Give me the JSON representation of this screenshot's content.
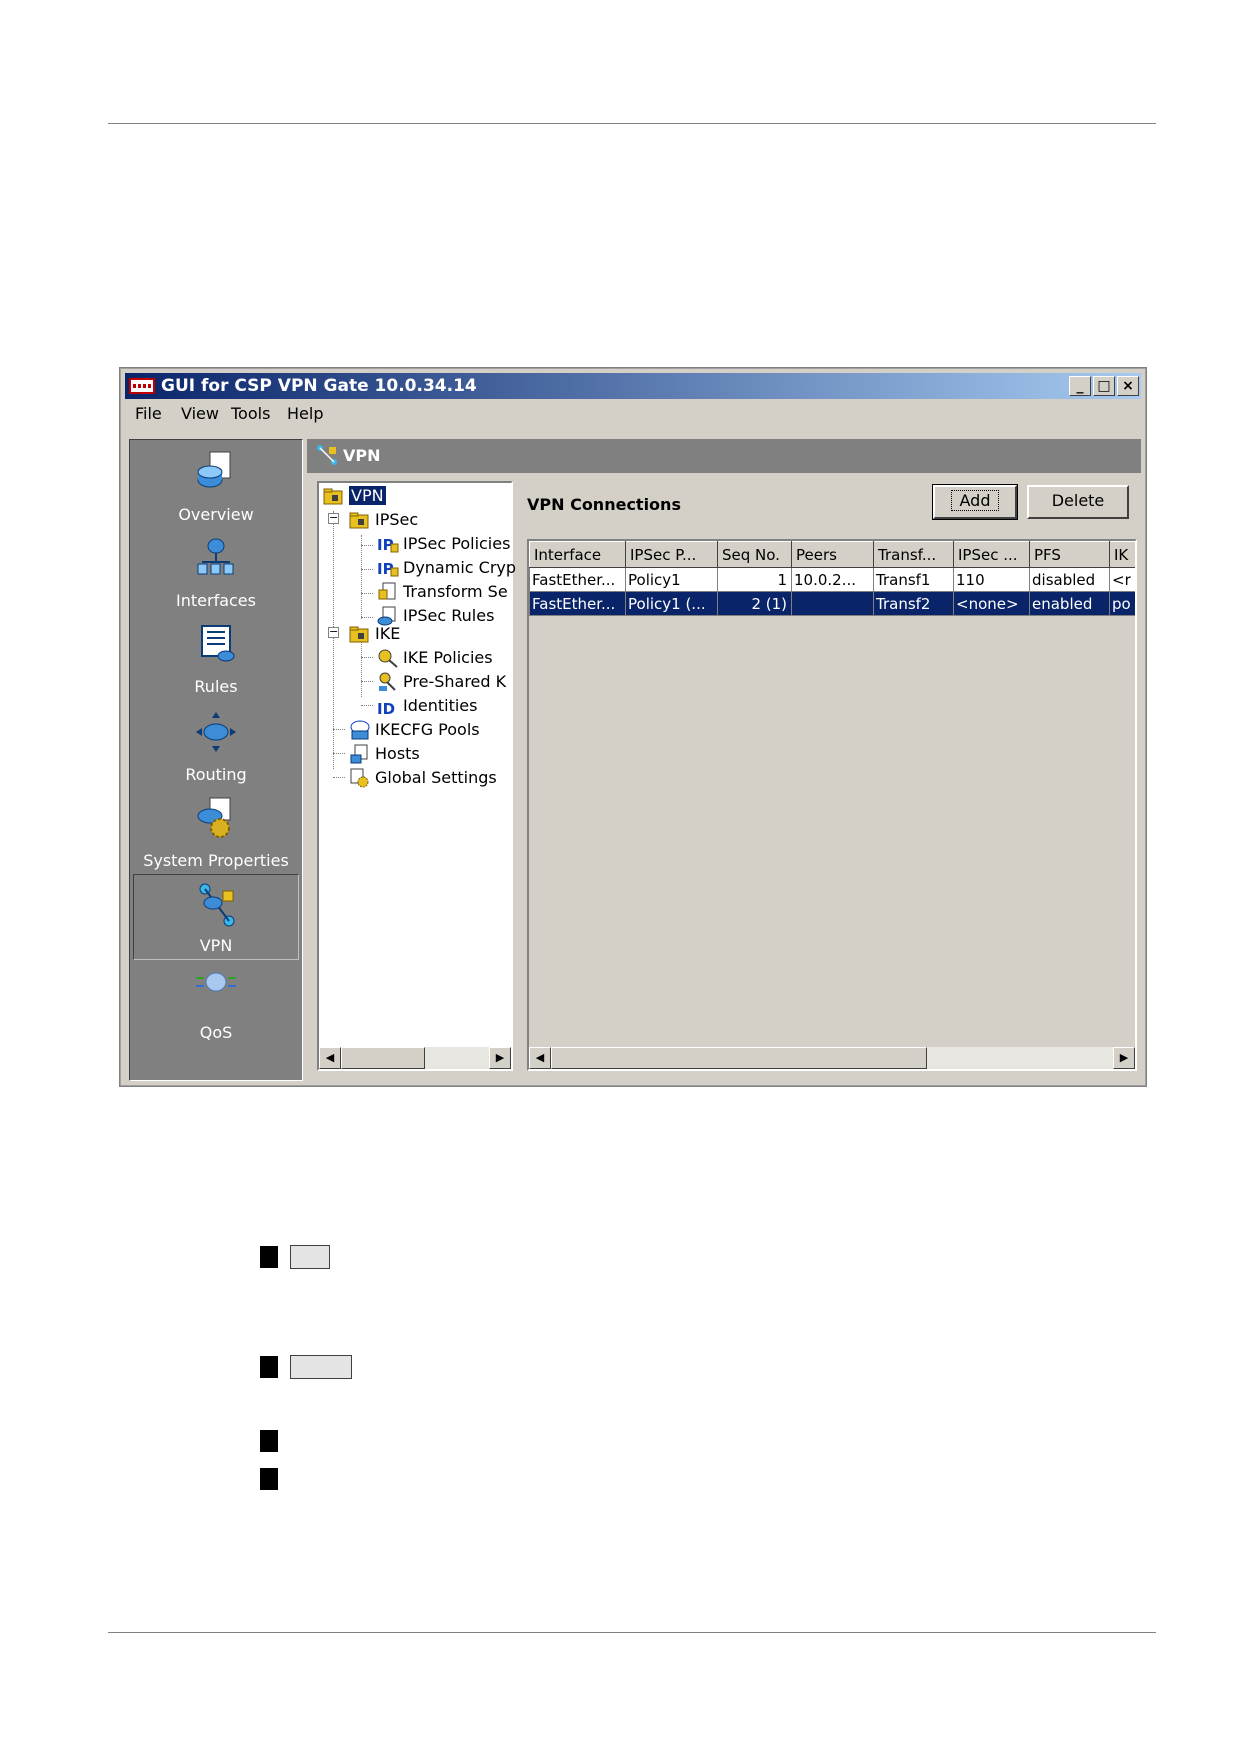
{
  "window": {
    "title": "GUI for CSP VPN Gate 10.0.34.14",
    "minimize": "_",
    "maximize": "□",
    "close": "×"
  },
  "menu": [
    "File",
    "View",
    "Tools",
    "Help"
  ],
  "nav": [
    {
      "label": "Overview",
      "icon": "overview-icon"
    },
    {
      "label": "Interfaces",
      "icon": "interfaces-icon"
    },
    {
      "label": "Rules",
      "icon": "rules-icon"
    },
    {
      "label": "Routing",
      "icon": "routing-icon"
    },
    {
      "label": "System Properties",
      "icon": "system-properties-icon"
    },
    {
      "label": "VPN",
      "icon": "vpn-icon",
      "active": true
    },
    {
      "label": "QoS",
      "icon": "qos-icon"
    }
  ],
  "panel": {
    "header": "VPN"
  },
  "tree": {
    "root": "VPN",
    "ipsec": "IPSec",
    "ipsec_children": [
      "IPSec Policies",
      "Dynamic Cryp",
      "Transform Se",
      "IPSec Rules"
    ],
    "ike": "IKE",
    "ike_children": [
      "IKE Policies",
      "Pre-Shared K",
      "Identities"
    ],
    "others": [
      "IKECFG Pools",
      "Hosts",
      "Global Settings"
    ]
  },
  "connections": {
    "title": "VPN Connections",
    "add_label": "Add",
    "delete_label": "Delete",
    "columns": [
      "Interface",
      "IPSec P...",
      "Seq No.",
      "Peers",
      "Transf...",
      "IPSec ...",
      "PFS",
      "IK"
    ],
    "rows": [
      {
        "cells": [
          "FastEther...",
          "Policy1",
          "1",
          "10.0.2...",
          "Transf1",
          "110",
          "disabled",
          "<r"
        ],
        "selected": false
      },
      {
        "cells": [
          "FastEther...",
          "Policy1 (...",
          "2 (1)",
          "",
          "Transf2",
          "<none>",
          "enabled",
          "po"
        ],
        "selected": true
      }
    ]
  }
}
